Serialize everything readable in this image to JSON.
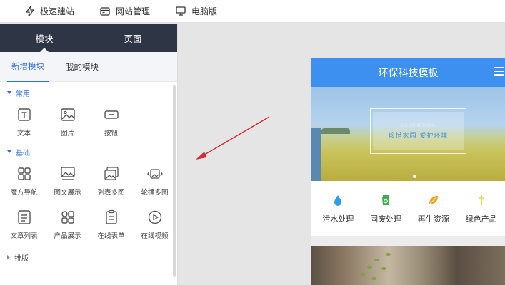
{
  "topbar": {
    "items": [
      {
        "label": "极速建站",
        "icon": "lightning-icon"
      },
      {
        "label": "网站管理",
        "icon": "card-icon"
      },
      {
        "label": "电脑版",
        "icon": "monitor-icon"
      }
    ]
  },
  "sidebar": {
    "tabs": [
      "模块",
      "页面"
    ],
    "subtabs": [
      "新增模块",
      "我的模块"
    ],
    "categories": {
      "common": {
        "label": "常用",
        "modules": [
          "文本",
          "图片",
          "按钮"
        ]
      },
      "basic": {
        "label": "基础",
        "modules": [
          "魔方导航",
          "图文展示",
          "列表多图",
          "轮播多图",
          "文章列表",
          "产品展示",
          "在线表单",
          "在线视频"
        ]
      },
      "layout": {
        "label": "排版"
      }
    }
  },
  "preview": {
    "title": "环保科技模板",
    "banner_small": "DO SOMETHING",
    "banner_text": "珍惜家园  爱护环境",
    "categories": [
      {
        "label": "污水处理",
        "icon": "water-drop-icon",
        "color": "#2d9de8"
      },
      {
        "label": "固废处理",
        "icon": "recycle-bin-icon",
        "color": "#3fae4a"
      },
      {
        "label": "再生资源",
        "icon": "leaf-icon",
        "color": "#f0a31c"
      },
      {
        "label": "绿色产品",
        "icon": "cross-icon",
        "color": "#e8d23a"
      }
    ]
  },
  "colors": {
    "accent": "#2e6fd8",
    "sidebar_header": "#2e3645",
    "preview_header": "#3d8ff0",
    "arrow": "#d62b2b"
  }
}
